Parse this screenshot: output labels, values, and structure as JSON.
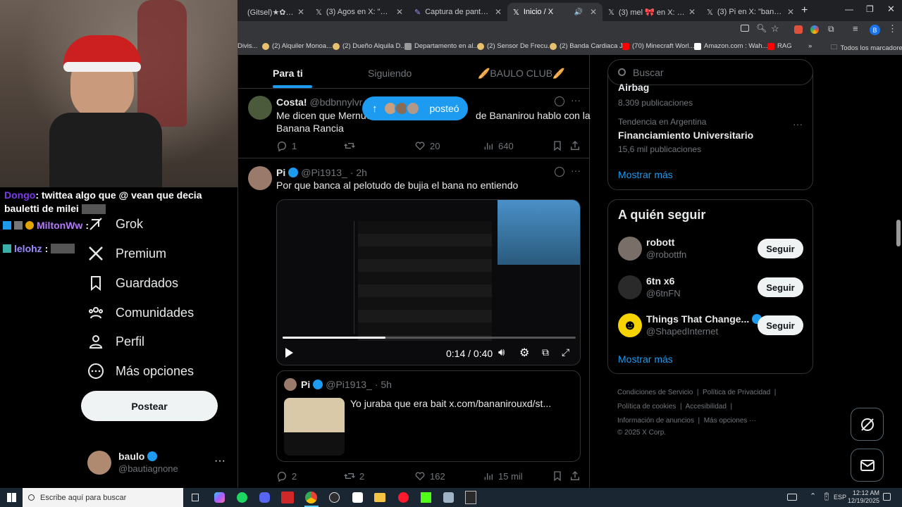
{
  "browser": {
    "tabs": [
      {
        "label": "(Gitsel)★✿⚡ en X: \"Lam"
      },
      {
        "label": "(3) Agos en X: \"@Lpgnit n"
      },
      {
        "label": "Captura de pantalla por L"
      },
      {
        "label": "Inicio / X"
      },
      {
        "label": "(3) mel 🎀 en X: \"elige vict"
      },
      {
        "label": "(3) Pi en X: \"bananirou se"
      }
    ],
    "profile_initial": "B",
    "bookmarks": [
      {
        "label": "Divis..."
      },
      {
        "label": "(2) Alquiler Monoa..."
      },
      {
        "label": "(2) Dueño Alquila D..."
      },
      {
        "label": "Departamento en al..."
      },
      {
        "label": "(2) Sensor De Frecu..."
      },
      {
        "label": "(2) Banda Cardiaca J..."
      },
      {
        "label": "(70) Minecraft Worl..."
      },
      {
        "label": "Amazon.com : Wah..."
      },
      {
        "label": "RAG"
      },
      {
        "label": "Todos los marcadores"
      }
    ]
  },
  "stream_chat": [
    {
      "user": "Dongo",
      "text": ": twittea algo que @ vean que decia bauletti de milei",
      "color": "#7c3aed"
    },
    {
      "user": "MiltonWw",
      "text": ":",
      "color": "#b47aff"
    },
    {
      "user": "lelohz",
      "text": ":",
      "color": "#9a8cff"
    }
  ],
  "nav": {
    "items": [
      {
        "label": "Grok"
      },
      {
        "label": "Premium"
      },
      {
        "label": "Guardados"
      },
      {
        "label": "Comunidades"
      },
      {
        "label": "Perfil"
      },
      {
        "label": "Más opciones"
      }
    ],
    "post_button": "Postear",
    "account": {
      "name": "baulo",
      "handle": "@bautiagnone"
    }
  },
  "feed": {
    "tabs": [
      "Para ti",
      "Siguiendo",
      "🥖BAULO CLUB🥖"
    ],
    "new_posts_pill": "posteó",
    "post1": {
      "name": "Costa!",
      "handle": "@bdbnnylvr",
      "text_a": "Me dicen que Mernue",
      "text_b": "de Bananirou hablo con la",
      "text_c": "Banana Rancia",
      "replies": "1",
      "likes": "20",
      "views": "640"
    },
    "post2": {
      "name": "Pi",
      "handle": "@Pi1913_",
      "time": "· 2h",
      "text": "Por que banca al pelotudo de bujia el bana no entiendo",
      "video_time": "0:14 / 0:40",
      "quote": {
        "name": "Pi",
        "handle": "@Pi1913_",
        "time": "· 5h",
        "text": "Yo juraba que era bait  x.com/bananirouxd/st..."
      },
      "replies": "2",
      "reposts": "2",
      "likes": "162",
      "views": "15 mil"
    }
  },
  "sidebar": {
    "search_placeholder": "Buscar",
    "trend_top_partial": "Airbag",
    "trend_top_count": "8.309 publicaciones",
    "trend_label": "Tendencia en Argentina",
    "trend_title": "Financiamiento Universitario",
    "trend_count": "15,6 mil publicaciones",
    "show_more": "Mostrar más",
    "who_to_follow_title": "A quién seguir",
    "suggestions": [
      {
        "name": "robott",
        "handle": "@robottfn"
      },
      {
        "name": "6tn x6",
        "handle": "@6tnFN"
      },
      {
        "name": "Things That Change...",
        "handle": "@ShapedInternet"
      }
    ],
    "follow_label": "Seguir",
    "show_more_2": "Mostrar más",
    "footer": [
      "Condiciones de Servicio",
      "Política de Privacidad",
      "Política de cookies",
      "Accesibilidad",
      "Información de anuncios",
      "Más opciones ···",
      "© 2025 X Corp."
    ]
  },
  "taskbar": {
    "search_placeholder": "Escribe aquí para buscar",
    "lang": "ESP",
    "time": "12:12 AM",
    "date": "12/19/2025"
  },
  "colors": {
    "accent": "#1d9bf0",
    "bg": "#000000",
    "border": "#2f3336",
    "muted": "#71767b"
  }
}
